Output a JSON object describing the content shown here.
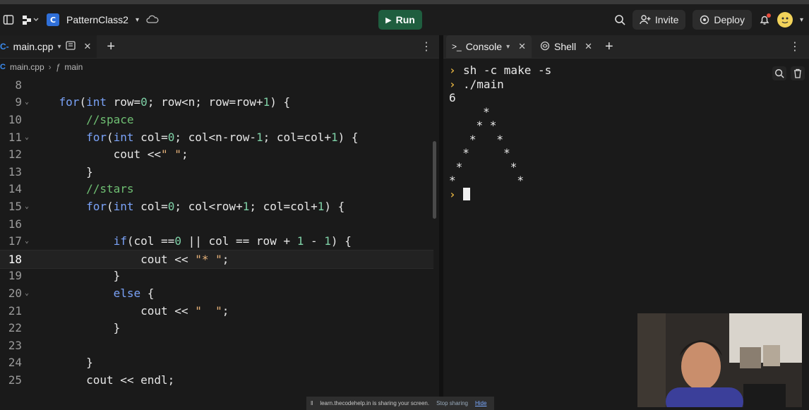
{
  "header": {
    "project_name": "PatternClass2",
    "run_label": "Run",
    "invite_label": "Invite",
    "deploy_label": "Deploy"
  },
  "editor": {
    "tab_label": "main.cpp",
    "breadcrumb_file": "main.cpp",
    "breadcrumb_func": "main",
    "lines": [
      {
        "n": "8",
        "text": ""
      },
      {
        "n": "9",
        "text": "    for(int row=0; row<n; row=row+1) {"
      },
      {
        "n": "10",
        "text": "        //space"
      },
      {
        "n": "11",
        "text": "        for(int col=0; col<n-row-1; col=col+1) {"
      },
      {
        "n": "12",
        "text": "            cout <<\" \";"
      },
      {
        "n": "13",
        "text": "        }"
      },
      {
        "n": "14",
        "text": "        //stars"
      },
      {
        "n": "15",
        "text": "        for(int col=0; col<row+1; col=col+1) {"
      },
      {
        "n": "16",
        "text": ""
      },
      {
        "n": "17",
        "text": "            if(col ==0 || col == row + 1 - 1) {"
      },
      {
        "n": "18",
        "text": "                cout << \"* \";"
      },
      {
        "n": "19",
        "text": "            }"
      },
      {
        "n": "20",
        "text": "            else {"
      },
      {
        "n": "21",
        "text": "                cout << \"  \";"
      },
      {
        "n": "22",
        "text": "            }"
      },
      {
        "n": "23",
        "text": ""
      },
      {
        "n": "24",
        "text": "        }"
      },
      {
        "n": "25",
        "text": "        cout << endl;"
      }
    ]
  },
  "console": {
    "tab_console": "Console",
    "tab_shell": "Shell",
    "lines": [
      {
        "prompt": true,
        "text": "sh -c make -s"
      },
      {
        "prompt": true,
        "text": "./main"
      },
      {
        "prompt": false,
        "text": "6"
      },
      {
        "prompt": false,
        "text": "     *"
      },
      {
        "prompt": false,
        "text": "    * *"
      },
      {
        "prompt": false,
        "text": "   *   *"
      },
      {
        "prompt": false,
        "text": "  *     *"
      },
      {
        "prompt": false,
        "text": " *       *"
      },
      {
        "prompt": false,
        "text": "*         *"
      }
    ]
  },
  "share_bar": {
    "message": "learn.thecodehelp.in is sharing your screen.",
    "stop_label": "Stop sharing",
    "hide_label": "Hide"
  },
  "colors": {
    "run_button": "#1f5e3f",
    "keyword": "#7aa2f7",
    "number": "#7fd1a7",
    "comment": "#6fbf73",
    "string": "#e8b37a"
  }
}
